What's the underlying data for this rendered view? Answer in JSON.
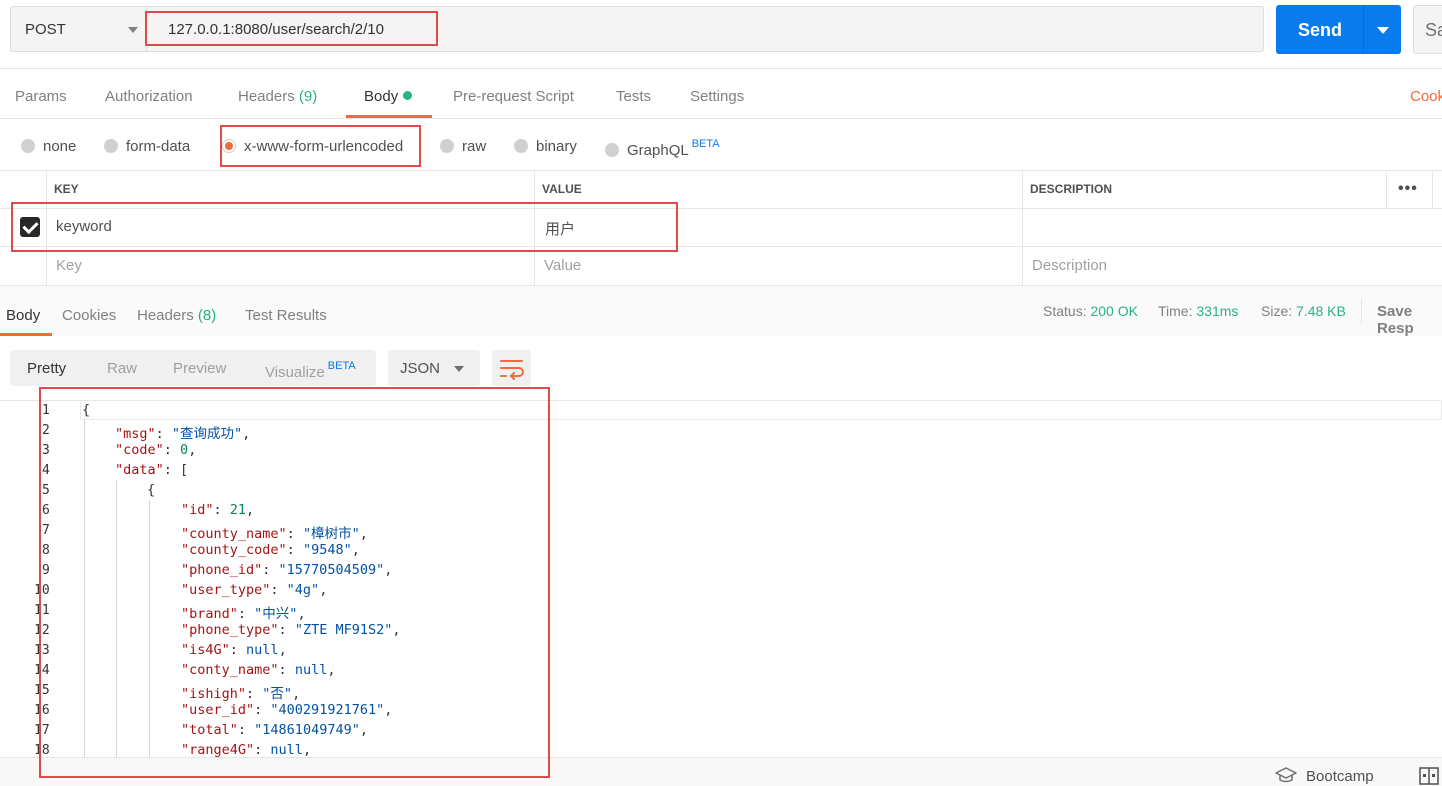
{
  "request": {
    "method": "POST",
    "url": "127.0.0.1:8080/user/search/2/10",
    "send_label": "Send",
    "save_label": "Sa"
  },
  "request_tabs": {
    "params": "Params",
    "authorization": "Authorization",
    "headers": "Headers",
    "headers_count": "(9)",
    "body": "Body",
    "prerequest": "Pre-request Script",
    "tests": "Tests",
    "settings": "Settings",
    "cookies": "Cook"
  },
  "body_types": {
    "none": "none",
    "form_data": "form-data",
    "urlencoded": "x-www-form-urlencoded",
    "raw": "raw",
    "binary": "binary",
    "graphql": "GraphQL",
    "graphql_badge": "BETA",
    "selected": "x-www-form-urlencoded"
  },
  "params_table": {
    "headers": {
      "key": "KEY",
      "value": "VALUE",
      "description": "DESCRIPTION"
    },
    "rows": [
      {
        "checked": true,
        "key": "keyword",
        "value": "用户",
        "description": ""
      }
    ],
    "placeholders": {
      "key": "Key",
      "value": "Value",
      "description": "Description"
    },
    "more_label": "•••"
  },
  "response_tabs": {
    "body": "Body",
    "cookies": "Cookies",
    "headers": "Headers",
    "headers_count": "(8)",
    "test_results": "Test Results"
  },
  "response_status": {
    "status_label": "Status:",
    "status_value": "200 OK",
    "time_label": "Time:",
    "time_value": "331ms",
    "size_label": "Size:",
    "size_value": "7.48 KB",
    "save_response": "Save Resp"
  },
  "view_modes": {
    "pretty": "Pretty",
    "raw": "Raw",
    "preview": "Preview",
    "visualize": "Visualize",
    "visualize_badge": "BETA",
    "format": "JSON"
  },
  "code": {
    "line_numbers": [
      "1",
      "2",
      "3",
      "4",
      "5",
      "6",
      "7",
      "8",
      "9",
      "10",
      "11",
      "12",
      "13",
      "14",
      "15",
      "16",
      "17",
      "18"
    ],
    "l1": "{",
    "l2_key": "\"msg\"",
    "l2_val": "\"查询成功\"",
    "l3_key": "\"code\"",
    "l3_val": "0",
    "l4_key": "\"data\"",
    "l4_val": "[",
    "l5": "{",
    "l6_key": "\"id\"",
    "l6_val": "21",
    "l7_key": "\"county_name\"",
    "l7_val": "\"樟树市\"",
    "l8_key": "\"county_code\"",
    "l8_val": "\"9548\"",
    "l9_key": "\"phone_id\"",
    "l9_val": "\"15770504509\"",
    "l10_key": "\"user_type\"",
    "l10_val": "\"4g\"",
    "l11_key": "\"brand\"",
    "l11_val": "\"中兴\"",
    "l12_key": "\"phone_type\"",
    "l12_val": "\"ZTE MF91S2\"",
    "l13_key": "\"is4G\"",
    "l13_val": "null",
    "l14_key": "\"conty_name\"",
    "l14_val": "null",
    "l15_key": "\"ishigh\"",
    "l15_val": "\"否\"",
    "l16_key": "\"user_id\"",
    "l16_val": "\"400291921761\"",
    "l17_key": "\"total\"",
    "l17_val": "\"14861049749\"",
    "l18_key": "\"range4G\"",
    "l18_val": "null"
  },
  "footer": {
    "bootcamp": "Bootcamp"
  },
  "colors": {
    "accent": "#f26b3a",
    "send": "#097bed",
    "success": "#26b47f",
    "annotation": "#e04a4a"
  }
}
